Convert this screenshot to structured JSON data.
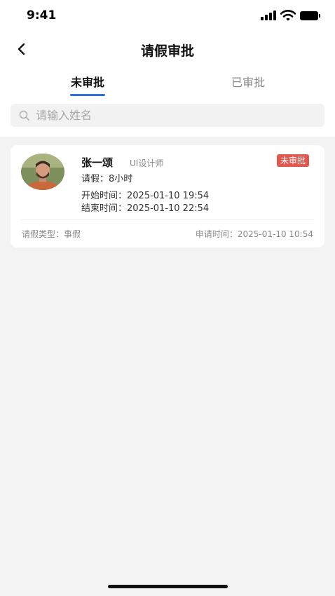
{
  "status_bar": {
    "time": "9:41"
  },
  "nav": {
    "title": "请假审批",
    "back_icon": "chevron-left-icon"
  },
  "tabs": [
    {
      "label": "未审批",
      "active": true
    },
    {
      "label": "已审批",
      "active": false
    }
  ],
  "search": {
    "placeholder": "请输入姓名",
    "value": "",
    "icon": "search-icon"
  },
  "requests": [
    {
      "name": "张一颂",
      "role": "UI设计师",
      "status": "未审批",
      "status_color": "#e2584f",
      "duration": "请假：8小时",
      "start": "开始时间：2025-01-10 19:54",
      "end": "结束时间：2025-01-10 22:54",
      "type": "请假类型：事假",
      "applied": "申请时间：2025-01-10 10:54"
    }
  ],
  "colors": {
    "accent": "#2f6fe4",
    "background": "#f3f3f3",
    "badge": "#e2584f"
  }
}
